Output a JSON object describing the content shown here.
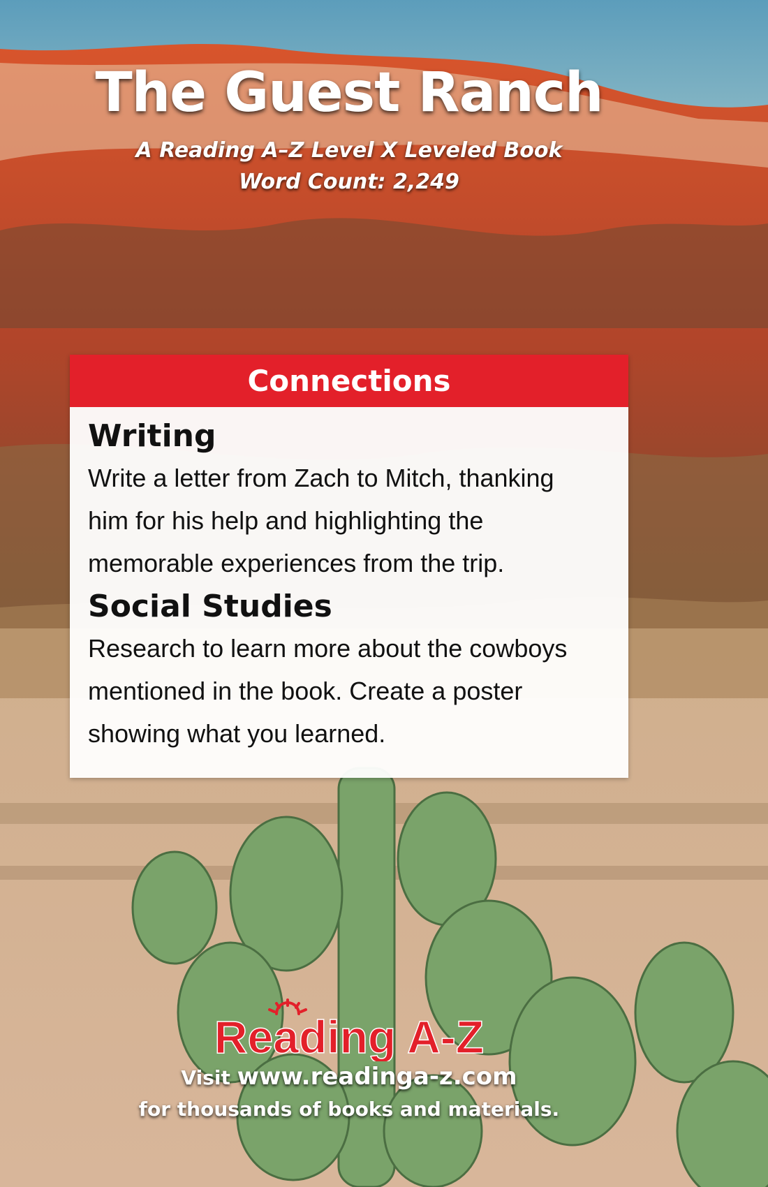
{
  "cover": {
    "title": "The Guest Ranch",
    "subtitle": "A Reading A–Z Level X Leveled Book",
    "word_count": "Word Count: 2,249"
  },
  "connections": {
    "header": "Connections",
    "sections": [
      {
        "title": "Writing",
        "lines": [
          "Write a letter from Zach to Mitch, thanking",
          "him for his help and highlighting the",
          "memorable experiences from the trip."
        ]
      },
      {
        "title": "Social Studies",
        "lines": [
          "Research to learn more about the cowboys",
          "mentioned in the book. Create a poster",
          "showing what you learned."
        ]
      }
    ]
  },
  "footer": {
    "logo_text": "Reading A-Z",
    "visit_prefix": "Visit",
    "url": "www.readinga-z.com",
    "tagline": "for thousands of books and materials."
  },
  "colors": {
    "brand_red": "#e3202a",
    "sky": "#5b9bb8"
  }
}
